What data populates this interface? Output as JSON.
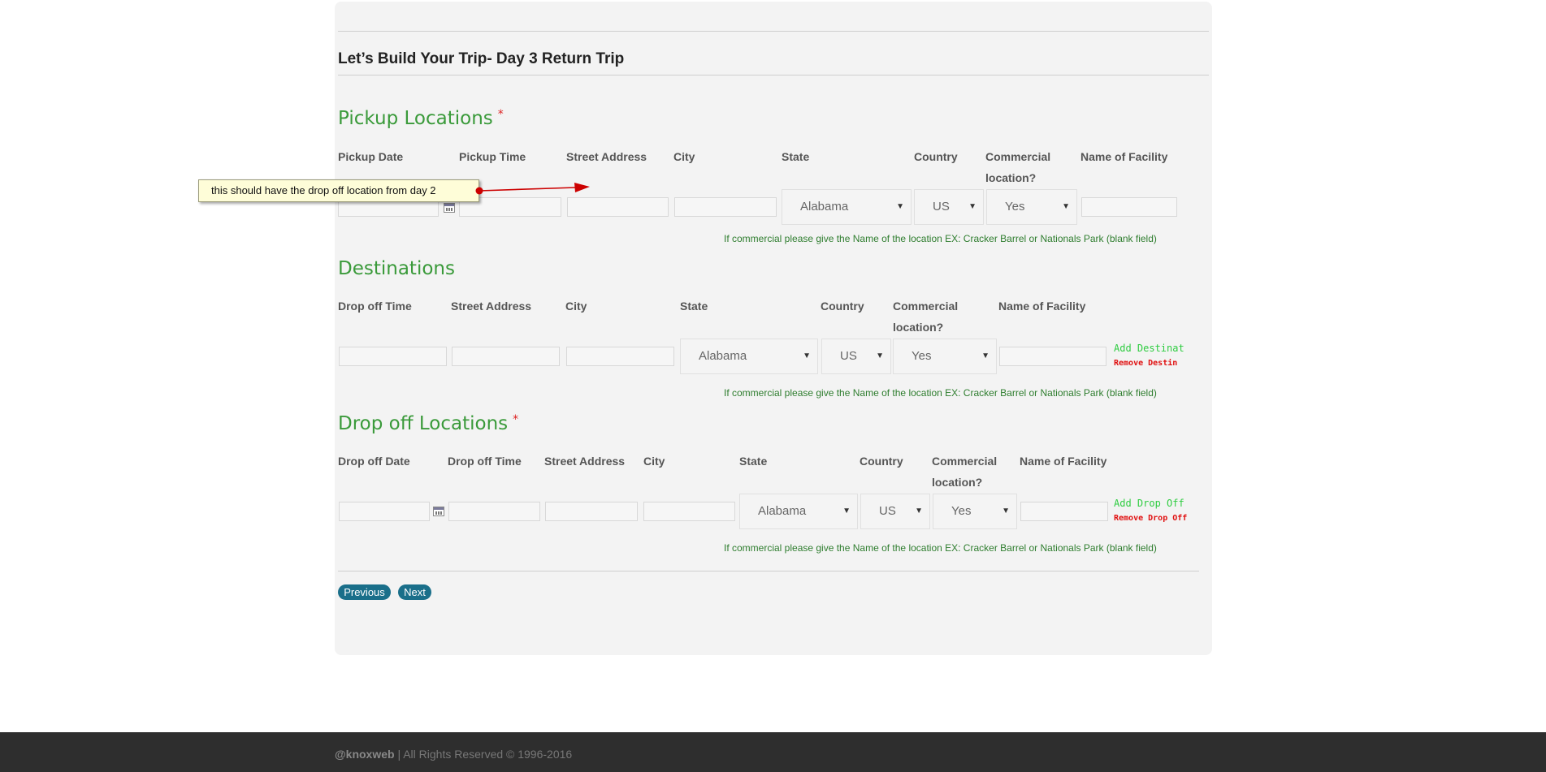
{
  "page_title": "Let’s Build Your Trip- Day 3 Return Trip",
  "pickup": {
    "title": "Pickup Locations",
    "required": "*",
    "labels": {
      "date": "Pickup Date",
      "time": "Pickup Time",
      "street": "Street Address",
      "city": "City",
      "state": "State",
      "country": "Country",
      "commercial1": "Commercial",
      "commercial2": "location?",
      "facility": "Name of Facility"
    },
    "state_value": "Alabama",
    "country_value": "US",
    "commercial_value": "Yes",
    "hint": "If commercial please give the Name of the location EX: Cracker Barrel or Nationals Park (blank field)"
  },
  "destinations": {
    "title": "Destinations",
    "labels": {
      "time": "Drop off Time",
      "street": "Street Address",
      "city": "City",
      "state": "State",
      "country": "Country",
      "commercial1": "Commercial",
      "commercial2": "location?",
      "facility": "Name of Facility"
    },
    "state_value": "Alabama",
    "country_value": "US",
    "commercial_value": "Yes",
    "add_link": "Add Destinat",
    "remove_link": "Remove Destin",
    "hint": "If commercial please give the Name of the location EX: Cracker Barrel or Nationals Park (blank field)"
  },
  "dropoff": {
    "title": "Drop off Locations",
    "required": "*",
    "labels": {
      "date": "Drop off Date",
      "time": "Drop off Time",
      "street": "Street Address",
      "city": "City",
      "state": "State",
      "country": "Country",
      "commercial1": "Commercial",
      "commercial2": "location?",
      "facility": "Name of Facility"
    },
    "state_value": "Alabama",
    "country_value": "US",
    "commercial_value": "Yes",
    "add_link": "Add Drop Off",
    "remove_link": "Remove Drop Off",
    "hint": "If commercial please give the Name of the location EX: Cracker Barrel or Nationals Park (blank field)"
  },
  "buttons": {
    "previous": "Previous",
    "next": "Next"
  },
  "annotation": "this should have the drop off location from day 2",
  "footer": {
    "brand": "@knoxweb",
    "text": " | All Rights Reserved © 1996-2016"
  },
  "colors": {
    "section": "#3a9a3a",
    "hint": "#2e7d2e",
    "add": "#2ecc40",
    "remove": "#e01010",
    "button": "#1a6f8a",
    "footer": "#2e2e2e"
  }
}
